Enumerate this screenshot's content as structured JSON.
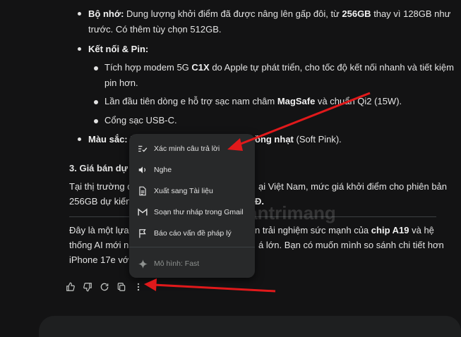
{
  "content": {
    "storage": {
      "label": "Bộ nhớ:",
      "text_a": " Dung lượng khởi điểm đã được nâng lên gấp đôi, từ ",
      "bold": "256GB",
      "text_b": " thay vì 128GB như",
      "line2": "trước. Có thêm tùy chọn 512GB."
    },
    "connectivity": {
      "label": "Kết nối & Pin:",
      "sub1_a": "Tích hợp modem 5G ",
      "sub1_bold": "C1X",
      "sub1_b": " do Apple tự phát triển, cho tốc độ kết nối nhanh và tiết kiệm",
      "sub1_line2": "pin hơn.",
      "sub2_a": "Lần đầu tiên dòng e hỗ trợ sạc nam châm ",
      "sub2_bold": "MagSafe",
      "sub2_b": " và chuẩn Qi2 (15W).",
      "sub3": "Cổng sạc USB-C."
    },
    "color": {
      "label": "Màu sắc:",
      "text_a": " Đ",
      "bold": "ồng nhạt",
      "text_b": " (Soft Pink)."
    },
    "section_heading": "3. Giá bán dự k",
    "price_line1_a": "Tại thị trường q",
    "price_line1_b": "ại Việt Nam, mức giá khởi điểm cho phiên bản",
    "price_line2_a": "256GB dự kiến n",
    "price_line2_bold": "Đ.",
    "closing_line1_a": "Đây là một lựa c",
    "closing_line1_b": "n trải nghiệm sức mạnh của ",
    "closing_line1_bold": "chip A19",
    "closing_line1_c": " và hệ",
    "closing_line2_a": "thống AI mới nh",
    "closing_line2_b": "á lớn. Bạn có muốn mình so sánh chi tiết hơn",
    "closing_line3": "iPhone 17e với n"
  },
  "watermark": "Quantrimang",
  "menu": {
    "items": [
      {
        "label": "Xác minh câu trả lời",
        "icon": "double-check-icon"
      },
      {
        "label": "Nghe",
        "icon": "speaker-icon"
      },
      {
        "label": "Xuất sang Tài liệu",
        "icon": "document-icon"
      },
      {
        "label": "Soạn thư nháp trong Gmail",
        "icon": "gmail-icon"
      },
      {
        "label": "Báo cáo vấn đề pháp lý",
        "icon": "flag-icon"
      }
    ],
    "model_label": "Mô hình: Fast"
  },
  "actions": [
    "thumb-up-icon",
    "thumb-down-icon",
    "refresh-icon",
    "copy-icon",
    "more-vert-icon"
  ],
  "colors": {
    "background": "#131314",
    "menu": "#28292a",
    "annotation_arrow": "#e0191b"
  }
}
